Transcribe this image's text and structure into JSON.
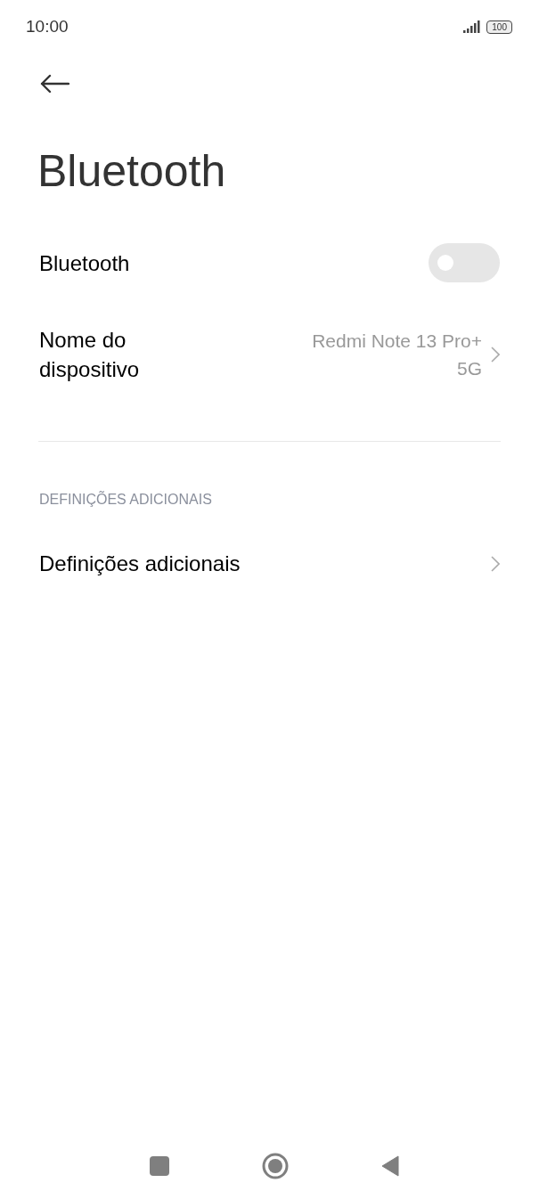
{
  "status_bar": {
    "time": "10:00",
    "battery": "100"
  },
  "title": "Bluetooth",
  "items": [
    {
      "kind": "toggle",
      "label": "Bluetooth",
      "on": false
    },
    {
      "kind": "value",
      "label": "Nome do dispositivo",
      "value": "Redmi Note 13 Pro+ 5G"
    }
  ],
  "sections": [
    {
      "header": "DEFINIÇÕES ADICIONAIS",
      "items": [
        {
          "kind": "link",
          "label": "Definições adicionais"
        }
      ]
    }
  ]
}
